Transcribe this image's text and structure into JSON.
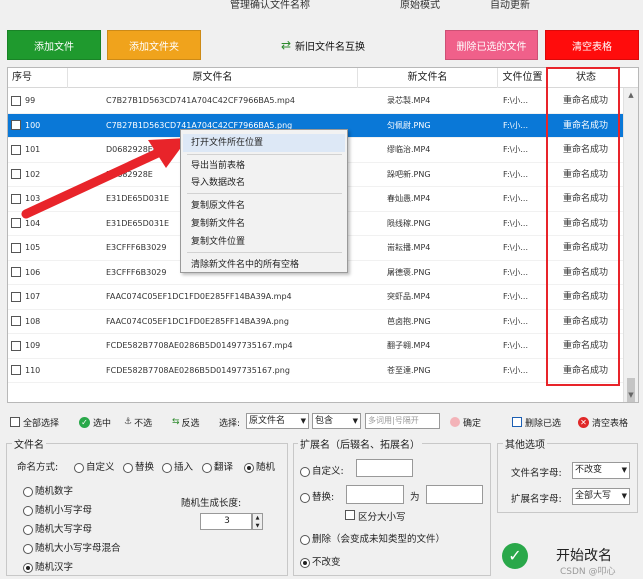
{
  "top_strip": {
    "a": "管理确认文件名称",
    "b": "原始模式",
    "c": "自动更新"
  },
  "toolbar": {
    "add_file": "添加文件",
    "add_folder": "添加文件夹",
    "swap_names": "新旧文件名互换",
    "delete_selected": "删除已选的文件",
    "clear_table": "清空表格"
  },
  "table": {
    "headers": {
      "no": "序号",
      "orig": "原文件名",
      "new": "新文件名",
      "pos": "文件位置",
      "status": "状态"
    },
    "rows": [
      {
        "no": "99",
        "orig": "C7B27B1D563CD741A704C42CF7966BA5.mp4",
        "new": "录芯製.MP4",
        "pos": "F:\\小...",
        "status": "重命名成功"
      },
      {
        "no": "100",
        "orig": "C7B27B1D563CD741A704C42CF7966BA5.png",
        "new": "匀佩尉.PNG",
        "pos": "F:\\小...",
        "status": "重命名成功"
      },
      {
        "no": "101",
        "orig": "D0682928E61F",
        "new": "缪临治.MP4",
        "pos": "F:\\小...",
        "status": "重命名成功"
      },
      {
        "no": "102",
        "orig": "D0682928E",
        "new": "跺吧新.PNG",
        "pos": "F:\\小...",
        "status": "重命名成功"
      },
      {
        "no": "103",
        "orig": "E31DE65D031E",
        "new": "春灿愚.MP4",
        "pos": "F:\\小...",
        "status": "重命名成功"
      },
      {
        "no": "104",
        "orig": "E31DE65D031E",
        "new": "陨线稼.PNG",
        "pos": "F:\\小...",
        "status": "重命名成功"
      },
      {
        "no": "105",
        "orig": "E3CFFF6B3029",
        "new": "耑耘播.MP4",
        "pos": "F:\\小...",
        "status": "重命名成功"
      },
      {
        "no": "106",
        "orig": "E3CFFF6B3029",
        "new": "屠德褒.PNG",
        "pos": "F:\\小...",
        "status": "重命名成功"
      },
      {
        "no": "107",
        "orig": "FAAC074C05EF1DC1FD0E285FF14BA39A.mp4",
        "new": "突虾品.MP4",
        "pos": "F:\\小...",
        "status": "重命名成功"
      },
      {
        "no": "108",
        "orig": "FAAC074C05EF1DC1FD0E285FF14BA39A.png",
        "new": "芭卤抱.PNG",
        "pos": "F:\\小...",
        "status": "重命名成功"
      },
      {
        "no": "109",
        "orig": "FCDE582B7708AE0286B5D01497735167.mp4",
        "new": "翻子翱.MP4",
        "pos": "F:\\小...",
        "status": "重命名成功"
      },
      {
        "no": "110",
        "orig": "FCDE582B7708AE0286B5D01497735167.png",
        "new": "苍至達.PNG",
        "pos": "F:\\小...",
        "status": "重命名成功"
      }
    ]
  },
  "context_menu": {
    "open_location": "打开文件所在位置",
    "export_table": "导出当前表格",
    "import_data": "导入数据改名",
    "copy_orig": "复制原文件名",
    "copy_new": "复制新文件名",
    "copy_pos": "复制文件位置",
    "clear_spaces": "清除新文件名中的所有空格"
  },
  "filter_bar": {
    "select_all": "全部选择",
    "select": "选中",
    "deselect": "不选",
    "invert": "反选",
    "choose_label": "选择:",
    "field_value": "原文件名",
    "match_value": "包含",
    "keyword_placeholder": "多词用|号隔开",
    "confirm": "确定",
    "delete_checked": "删除已选",
    "clear_table": "清空表格"
  },
  "filename_group": {
    "title": "文件名",
    "mode_label": "命名方式:",
    "modes": [
      "自定义",
      "替换",
      "插入",
      "翻译",
      "随机"
    ],
    "random_opts": [
      "随机数字",
      "随机小写字母",
      "随机大写字母",
      "随机大小写字母混合",
      "随机汉字"
    ],
    "length_label": "随机生成长度:",
    "length_value": "3"
  },
  "ext_group": {
    "title": "扩展名（后辍名、拓展名）",
    "custom": "自定义:",
    "replace": "替换:",
    "to": "为",
    "case_sensitive": "区分大小写",
    "delete": "删除（会变成未知类型的文件）",
    "unchanged": "不改变"
  },
  "other_group": {
    "title": "其他选项",
    "filename_case_label": "文件名字母:",
    "filename_case_value": "不改变",
    "ext_case_label": "扩展名字母:",
    "ext_case_value": "全部大写"
  },
  "start": {
    "label": "开始改名"
  },
  "watermark": "CSDN @叩心"
}
